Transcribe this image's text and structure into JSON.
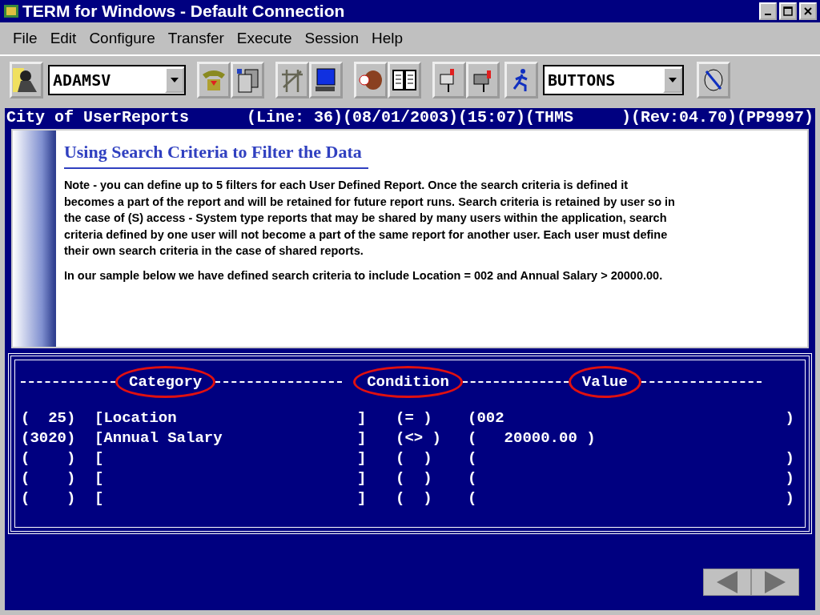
{
  "window": {
    "title": "TERM for Windows - Default Connection"
  },
  "menu": [
    {
      "label": "File"
    },
    {
      "label": "Edit"
    },
    {
      "label": "Configure"
    },
    {
      "label": "Transfer"
    },
    {
      "label": "Execute"
    },
    {
      "label": "Session"
    },
    {
      "label": "Help"
    }
  ],
  "toolbar": {
    "session_dropdown": "ADAMSV",
    "buttons_dropdown": "BUTTONS"
  },
  "status_line": {
    "left": "City of UserReports",
    "right": "(Line: 36)(08/01/2003)(15:07)(THMS     )(Rev:04.70)(PP9997)"
  },
  "callout": {
    "heading": "Using Search Criteria to Filter the Data",
    "paragraphs": [
      "Note -  you can define up to 5 filters for each User Defined Report.   Once the search criteria is defined it becomes a part of the report and will be retained for future report runs.   Search criteria is retained by user so in the case of (S) access - System type reports that may be shared by many users within the application, search criteria defined by one user will not become a part of the same report for another user.  Each user must define their own search criteria in the case of shared reports.",
      "In our sample below we have defined search criteria to include Location = 002 and Annual Salary > 20000.00."
    ]
  },
  "filters": {
    "columns": [
      "Category",
      "Condition",
      "Value"
    ],
    "rows": [
      {
        "id": "(  25)",
        "category": "[Location",
        "category_end": "]",
        "condition": "(= )",
        "value": "(002",
        "value_end": ")"
      },
      {
        "id": "(3020)",
        "category": "[Annual Salary",
        "category_end": "]",
        "condition": "(<> )",
        "value": "(   20000.00 )"
      },
      {
        "id": "(    )",
        "category": "[",
        "category_end": "]",
        "condition": "(  )",
        "value": "(",
        "value_end": ")"
      },
      {
        "id": "(    )",
        "category": "[",
        "category_end": "]",
        "condition": "(  )",
        "value": "(",
        "value_end": ")"
      },
      {
        "id": "(    )",
        "category": "[",
        "category_end": "]",
        "condition": "(  )",
        "value": "(",
        "value_end": ")"
      }
    ]
  }
}
